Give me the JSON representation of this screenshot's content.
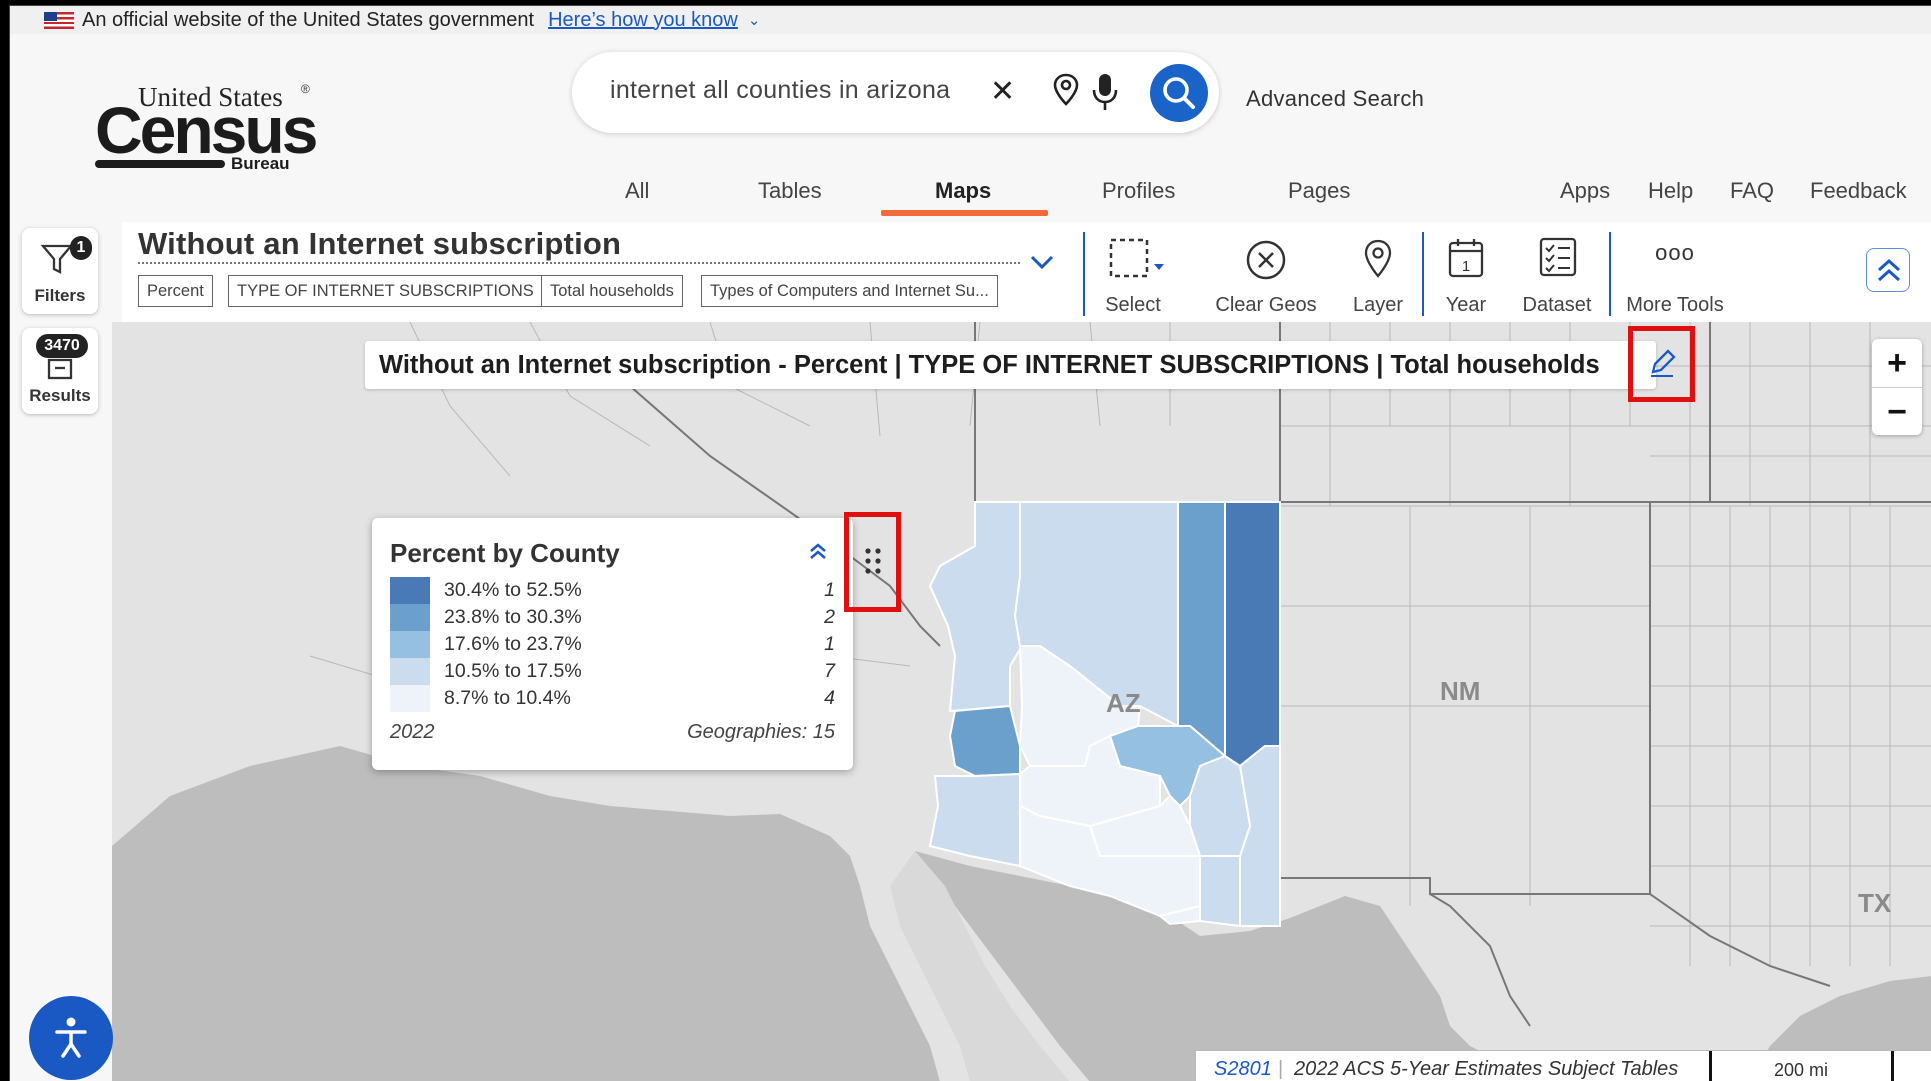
{
  "gov_banner": {
    "text": "An official website of the United States government",
    "link": "Here’s how you know"
  },
  "logo": {
    "line1": "United States",
    "line2": "Census",
    "line3": "Bureau",
    "reg": "®"
  },
  "search": {
    "value": "internet all counties in arizona",
    "advanced_label": "Advanced Search"
  },
  "main_tabs": [
    {
      "label": "All",
      "active": false
    },
    {
      "label": "Tables",
      "active": false
    },
    {
      "label": "Maps",
      "active": true
    },
    {
      "label": "Profiles",
      "active": false
    },
    {
      "label": "Pages",
      "active": false
    }
  ],
  "util_nav": [
    "Apps",
    "Help",
    "FAQ",
    "Feedback"
  ],
  "rail": {
    "filters_label": "Filters",
    "filters_count": "1",
    "results_label": "Results",
    "results_count": "3470"
  },
  "toolbar": {
    "title": "Without an Internet subscription",
    "chips": [
      "Percent",
      "TYPE OF INTERNET SUBSCRIPTIONS",
      "Total households",
      "Types of Computers and Internet Su..."
    ],
    "tools": [
      "Select",
      "Clear Geos",
      "Layer",
      "Year",
      "Dataset",
      "More Tools"
    ],
    "year_icon_day": "1",
    "more_icon": "ooo"
  },
  "map": {
    "title_bar": "Without an Internet subscription - Percent | TYPE OF INTERNET SUBSCRIPTIONS | Total households",
    "state_labels": [
      "AZ",
      "NM",
      "TX"
    ],
    "zoom_in": "+",
    "zoom_out": "−",
    "colors": {
      "c1": "#4a7ab5",
      "c2": "#6b9fcc",
      "c3": "#95c0e1",
      "c4": "#cadced",
      "c5": "#eef2f9",
      "neighbor": "#e3e3e3",
      "ocean": "#bdbdbd",
      "highlight": "#e01010"
    }
  },
  "legend": {
    "title": "Percent by County",
    "rows": [
      {
        "range": "30.4% to 52.5%",
        "count": "1",
        "color": "#4a7ab5"
      },
      {
        "range": "23.8% to 30.3%",
        "count": "2",
        "color": "#6b9fcc"
      },
      {
        "range": "17.6% to 23.7%",
        "count": "1",
        "color": "#95c0e1"
      },
      {
        "range": "10.5% to 17.5%",
        "count": "7",
        "color": "#cadced"
      },
      {
        "range": "8.7% to 10.4%",
        "count": "4",
        "color": "#eef2f9"
      }
    ],
    "year": "2022",
    "geographies": "Geographies: 15"
  },
  "footer": {
    "table_id": "S2801",
    "sep": "|",
    "source": "2022 ACS 5-Year Estimates Subject Tables",
    "scale": "200 mi"
  }
}
